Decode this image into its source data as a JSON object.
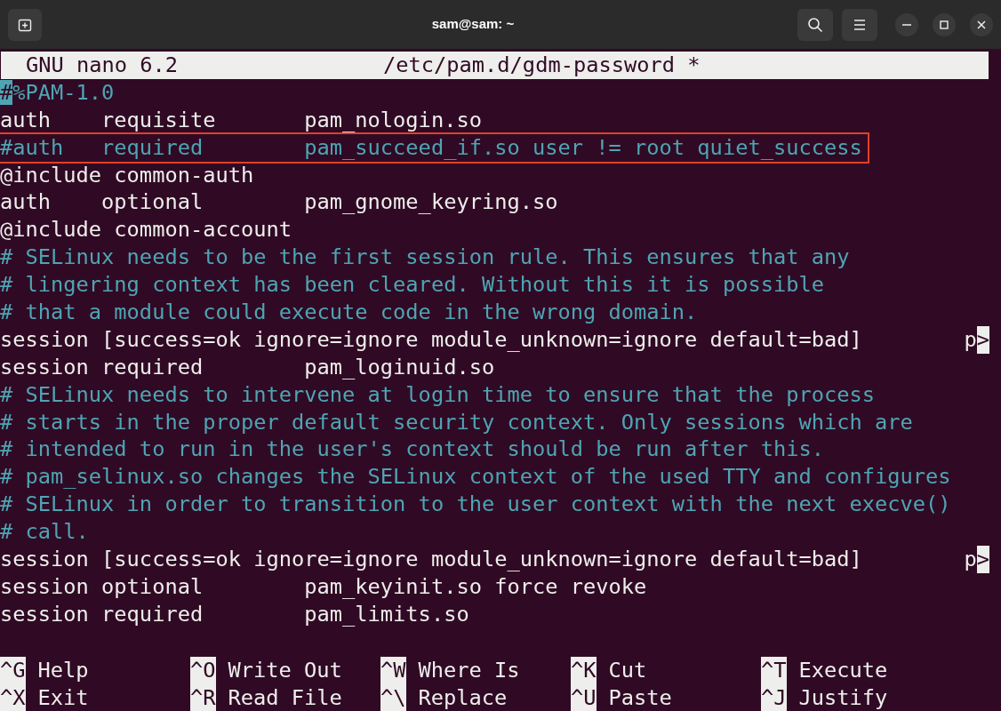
{
  "window": {
    "title": "sam@sam: ~"
  },
  "header": {
    "program": "GNU nano 6.2",
    "file": "/etc/pam.d/gdm-password *"
  },
  "lines": [
    {
      "kind": "comment",
      "text": "#%PAM-1.0",
      "cursor": true,
      "boxed": false
    },
    {
      "kind": "code",
      "text": "auth    requisite       pam_nologin.so",
      "cursor": false,
      "boxed": false
    },
    {
      "kind": "comment",
      "text": "#auth   required        pam_succeed_if.so user != root quiet_success",
      "cursor": false,
      "boxed": true
    },
    {
      "kind": "code",
      "text": "@include common-auth",
      "cursor": false,
      "boxed": false
    },
    {
      "kind": "code",
      "text": "auth    optional        pam_gnome_keyring.so",
      "cursor": false,
      "boxed": false
    },
    {
      "kind": "code",
      "text": "@include common-account",
      "cursor": false,
      "boxed": false
    },
    {
      "kind": "comment",
      "text": "# SELinux needs to be the first session rule. This ensures that any",
      "cursor": false,
      "boxed": false
    },
    {
      "kind": "comment",
      "text": "# lingering context has been cleared. Without this it is possible",
      "cursor": false,
      "boxed": false
    },
    {
      "kind": "comment",
      "text": "# that a module could execute code in the wrong domain.",
      "cursor": false,
      "boxed": false
    },
    {
      "kind": "code",
      "text": "session [success=ok ignore=ignore module_unknown=ignore default=bad]",
      "tail": "p",
      "more": ">",
      "cursor": false,
      "boxed": false
    },
    {
      "kind": "code",
      "text": "session required        pam_loginuid.so",
      "cursor": false,
      "boxed": false
    },
    {
      "kind": "comment",
      "text": "# SELinux needs to intervene at login time to ensure that the process",
      "cursor": false,
      "boxed": false
    },
    {
      "kind": "comment",
      "text": "# starts in the proper default security context. Only sessions which are",
      "cursor": false,
      "boxed": false
    },
    {
      "kind": "comment",
      "text": "# intended to run in the user's context should be run after this.",
      "cursor": false,
      "boxed": false
    },
    {
      "kind": "comment",
      "text": "# pam_selinux.so changes the SELinux context of the used TTY and configures",
      "cursor": false,
      "boxed": false
    },
    {
      "kind": "comment",
      "text": "# SELinux in order to transition to the user context with the next execve()",
      "cursor": false,
      "boxed": false
    },
    {
      "kind": "comment",
      "text": "# call.",
      "cursor": false,
      "boxed": false
    },
    {
      "kind": "code",
      "text": "session [success=ok ignore=ignore module_unknown=ignore default=bad]",
      "tail": "p",
      "more": ">",
      "cursor": false,
      "boxed": false
    },
    {
      "kind": "code",
      "text": "session optional        pam_keyinit.so force revoke",
      "cursor": false,
      "boxed": false
    },
    {
      "kind": "code",
      "text": "session required        pam_limits.so",
      "cursor": false,
      "boxed": false
    }
  ],
  "shortcuts": [
    [
      {
        "key": "^G",
        "label": "Help"
      },
      {
        "key": "^O",
        "label": "Write Out"
      },
      {
        "key": "^W",
        "label": "Where Is"
      },
      {
        "key": "^K",
        "label": "Cut"
      },
      {
        "key": "^T",
        "label": "Execute"
      }
    ],
    [
      {
        "key": "^X",
        "label": "Exit"
      },
      {
        "key": "^R",
        "label": "Read File"
      },
      {
        "key": "^\\",
        "label": "Replace"
      },
      {
        "key": "^U",
        "label": "Paste"
      },
      {
        "key": "^J",
        "label": "Justify"
      }
    ]
  ]
}
